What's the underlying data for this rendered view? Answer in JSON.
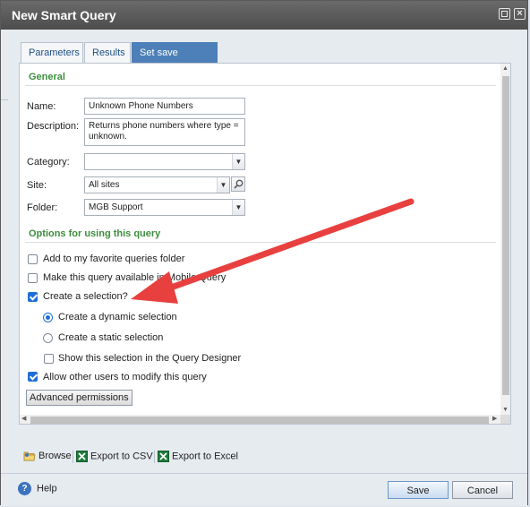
{
  "window": {
    "title": "New Smart Query"
  },
  "tabs": [
    {
      "label": "Parameters",
      "active": false
    },
    {
      "label": "Results",
      "active": false
    },
    {
      "label": "Set save options",
      "active": true
    }
  ],
  "general": {
    "heading": "General",
    "name_label": "Name:",
    "name_value": "Unknown Phone Numbers",
    "description_label": "Description:",
    "description_value": "Returns phone numbers where type =\nunknown.",
    "category_label": "Category:",
    "category_value": "",
    "site_label": "Site:",
    "site_value": "All sites",
    "folder_label": "Folder:",
    "folder_value": "MGB Support"
  },
  "options": {
    "heading": "Options for using this query",
    "add_favorite": {
      "label": "Add to my favorite queries folder",
      "checked": false
    },
    "make_available": {
      "label": "Make this query available in Mobile Query",
      "checked": false
    },
    "create_selection": {
      "label": "Create a selection?",
      "checked": true
    },
    "dynamic_selection": {
      "label": "Create a dynamic selection",
      "checked": true
    },
    "static_selection": {
      "label": "Create a static selection",
      "checked": false
    },
    "show_in_designer": {
      "label": "Show this selection in the Query Designer",
      "checked": false
    },
    "allow_modify": {
      "label": "Allow other users to modify this query",
      "checked": true
    },
    "advanced_button": "Advanced permissions"
  },
  "toolbar": {
    "browse": "Browse",
    "export_csv": "Export to CSV",
    "export_excel": "Export to Excel"
  },
  "footer": {
    "help": "Help",
    "save": "Save",
    "cancel": "Cancel"
  },
  "colors": {
    "accent": "#4d7fb8",
    "section_green": "#3e8e3e",
    "annotation_arrow": "#e8403f"
  },
  "icons": {
    "browse": "folder-icon",
    "export_csv": "excel-icon",
    "export_excel": "excel-icon",
    "help": "help-icon",
    "site_search": "search-icon"
  }
}
